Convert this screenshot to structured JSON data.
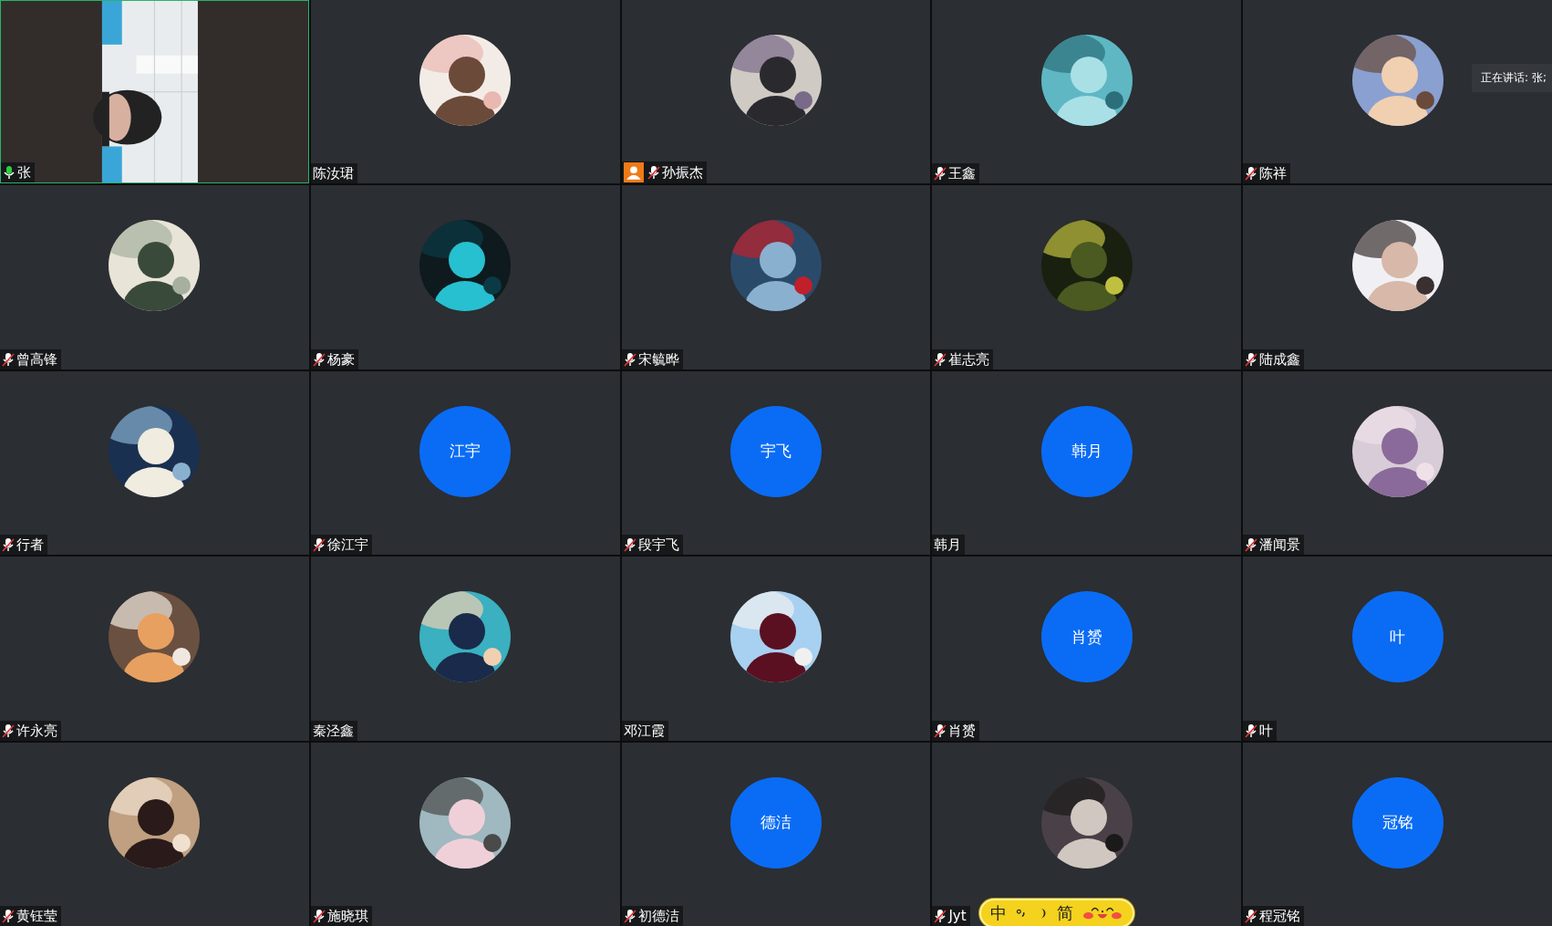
{
  "tiles": [
    {
      "name": "张",
      "mic_icon": true,
      "muted": false,
      "host": false,
      "speaking": true,
      "avatar": {
        "kind": "video"
      }
    },
    {
      "name": "陈汝珺",
      "mic_icon": false,
      "host": false,
      "speaking": false
    },
    {
      "name": "孙振杰",
      "mic_icon": true,
      "muted": true,
      "host": true,
      "speaking": false
    },
    {
      "name": "王鑫",
      "mic_icon": true,
      "muted": true,
      "host": false,
      "speaking": false
    },
    {
      "name": "陈祥",
      "mic_icon": true,
      "muted": true,
      "host": false,
      "speaking": false
    },
    {
      "name": "曾高锋",
      "mic_icon": true,
      "muted": true,
      "host": false,
      "speaking": false
    },
    {
      "name": "杨豪",
      "mic_icon": true,
      "muted": true,
      "host": false,
      "speaking": false
    },
    {
      "name": "宋毓晔",
      "mic_icon": true,
      "muted": true,
      "host": false,
      "speaking": false
    },
    {
      "name": "崔志亮",
      "mic_icon": true,
      "muted": true,
      "host": false,
      "speaking": false
    },
    {
      "name": "陆成鑫",
      "mic_icon": true,
      "muted": true,
      "host": false,
      "speaking": false
    },
    {
      "name": "行者",
      "mic_icon": true,
      "muted": true,
      "host": false,
      "speaking": false
    },
    {
      "name": "徐江宇",
      "mic_icon": true,
      "muted": true,
      "host": false,
      "speaking": false,
      "avatar": {
        "kind": "initials",
        "text": "江宇"
      }
    },
    {
      "name": "段宇飞",
      "mic_icon": true,
      "muted": true,
      "host": false,
      "speaking": false,
      "avatar": {
        "kind": "initials",
        "text": "宇飞"
      }
    },
    {
      "name": "韩月",
      "mic_icon": false,
      "host": false,
      "speaking": false,
      "avatar": {
        "kind": "initials",
        "text": "韩月"
      }
    },
    {
      "name": "潘闻景",
      "mic_icon": true,
      "muted": true,
      "host": false,
      "speaking": false
    },
    {
      "name": "许永亮",
      "mic_icon": true,
      "muted": true,
      "host": false,
      "speaking": false
    },
    {
      "name": "秦泾鑫",
      "mic_icon": false,
      "host": false,
      "speaking": false
    },
    {
      "name": "邓江霞",
      "mic_icon": false,
      "host": false,
      "speaking": false
    },
    {
      "name": "肖赟",
      "mic_icon": true,
      "muted": true,
      "host": false,
      "speaking": false,
      "avatar": {
        "kind": "initials",
        "text": "肖赟"
      }
    },
    {
      "name": "叶",
      "mic_icon": true,
      "muted": true,
      "host": false,
      "speaking": false,
      "avatar": {
        "kind": "initials",
        "text": "叶"
      }
    },
    {
      "name": "黄钰莹",
      "mic_icon": true,
      "muted": true,
      "host": false,
      "speaking": false
    },
    {
      "name": "施晓琪",
      "mic_icon": true,
      "muted": true,
      "host": false,
      "speaking": false
    },
    {
      "name": "初德洁",
      "mic_icon": true,
      "muted": true,
      "host": false,
      "speaking": false,
      "avatar": {
        "kind": "initials",
        "text": "德洁"
      }
    },
    {
      "name": "Jyt",
      "mic_icon": true,
      "muted": true,
      "host": false,
      "speaking": false
    },
    {
      "name": "程冠铭",
      "mic_icon": true,
      "muted": true,
      "host": false,
      "speaking": false,
      "avatar": {
        "kind": "initials",
        "text": "冠铭"
      }
    }
  ],
  "speaking_tooltip": "正在讲话: 张;",
  "ime_bar": {
    "mode": "中",
    "script": "简"
  }
}
